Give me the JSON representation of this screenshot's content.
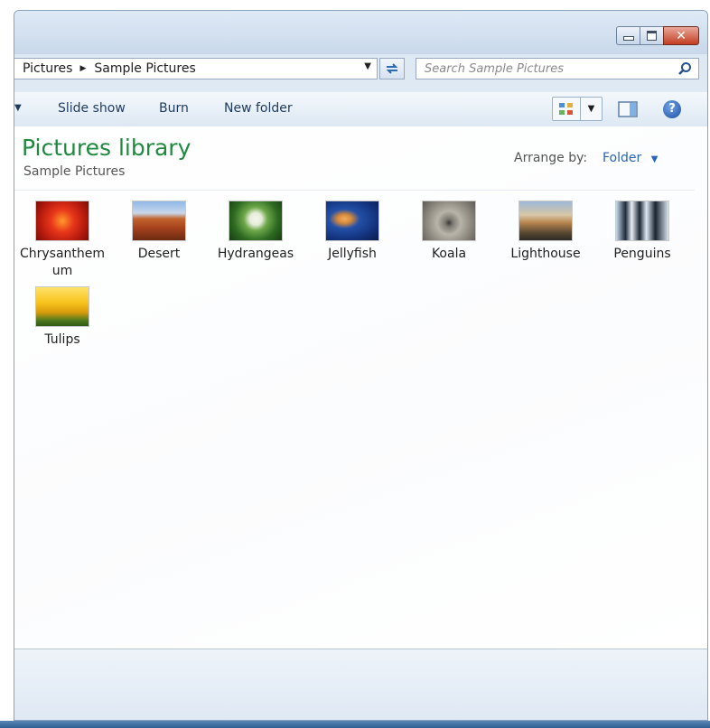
{
  "address": {
    "crumbs": [
      "Pictures",
      "Sample Pictures"
    ]
  },
  "search": {
    "placeholder": "Search Sample Pictures"
  },
  "toolbar": {
    "slideshow_label": "Slide show",
    "burn_label": "Burn",
    "new_folder_label": "New folder"
  },
  "header": {
    "title": "Pictures library",
    "subtitle": "Sample Pictures",
    "arrange_label": "Arrange by:",
    "arrange_value": "Folder"
  },
  "files": [
    {
      "name": "Chrysanthemum",
      "icon": "chrysanthemum-thumbnail"
    },
    {
      "name": "Desert",
      "icon": "desert-thumbnail"
    },
    {
      "name": "Hydrangeas",
      "icon": "hydrangeas-thumbnail"
    },
    {
      "name": "Jellyfish",
      "icon": "jellyfish-thumbnail"
    },
    {
      "name": "Koala",
      "icon": "koala-thumbnail"
    },
    {
      "name": "Lighthouse",
      "icon": "lighthouse-thumbnail"
    },
    {
      "name": "Penguins",
      "icon": "penguins-thumbnail"
    },
    {
      "name": "Tulips",
      "icon": "tulips-thumbnail"
    }
  ],
  "colors": {
    "library_title": "#1e8a3e",
    "link_blue": "#2a64b8",
    "chrome": "#dfe9f4"
  }
}
